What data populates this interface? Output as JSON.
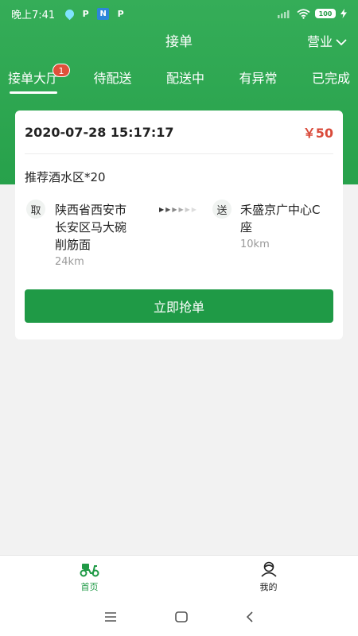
{
  "status_bar": {
    "time": "晚上7:41",
    "app1": "P",
    "app2": "N",
    "app3": "P",
    "battery": "100"
  },
  "header": {
    "title": "接单",
    "business_label": "营业"
  },
  "tabs": [
    {
      "label": "接单大厅",
      "badge": "1"
    },
    {
      "label": "待配送"
    },
    {
      "label": "配送中"
    },
    {
      "label": "有异常"
    },
    {
      "label": "已完成"
    }
  ],
  "order": {
    "time": "2020-07-28 15:17:17",
    "price": "￥50",
    "title": "推荐酒水区*20",
    "pickup": {
      "icon_label": "取",
      "address_line1": "陕西省西安市",
      "address_line2": "长安区马大碗",
      "address_line3": "削筋面",
      "distance": "24km"
    },
    "delivery": {
      "icon_label": "送",
      "address_line1": "禾盛京广中心C",
      "address_line2": "座",
      "distance": "10km"
    },
    "button_label": "立即抢单"
  },
  "bottom_tabs": [
    {
      "label": "首页"
    },
    {
      "label": "我的"
    }
  ],
  "colors": {
    "primary": "#1f9a46",
    "header": "#2fa853",
    "price": "#d94a3a",
    "badge": "#e0513a"
  }
}
